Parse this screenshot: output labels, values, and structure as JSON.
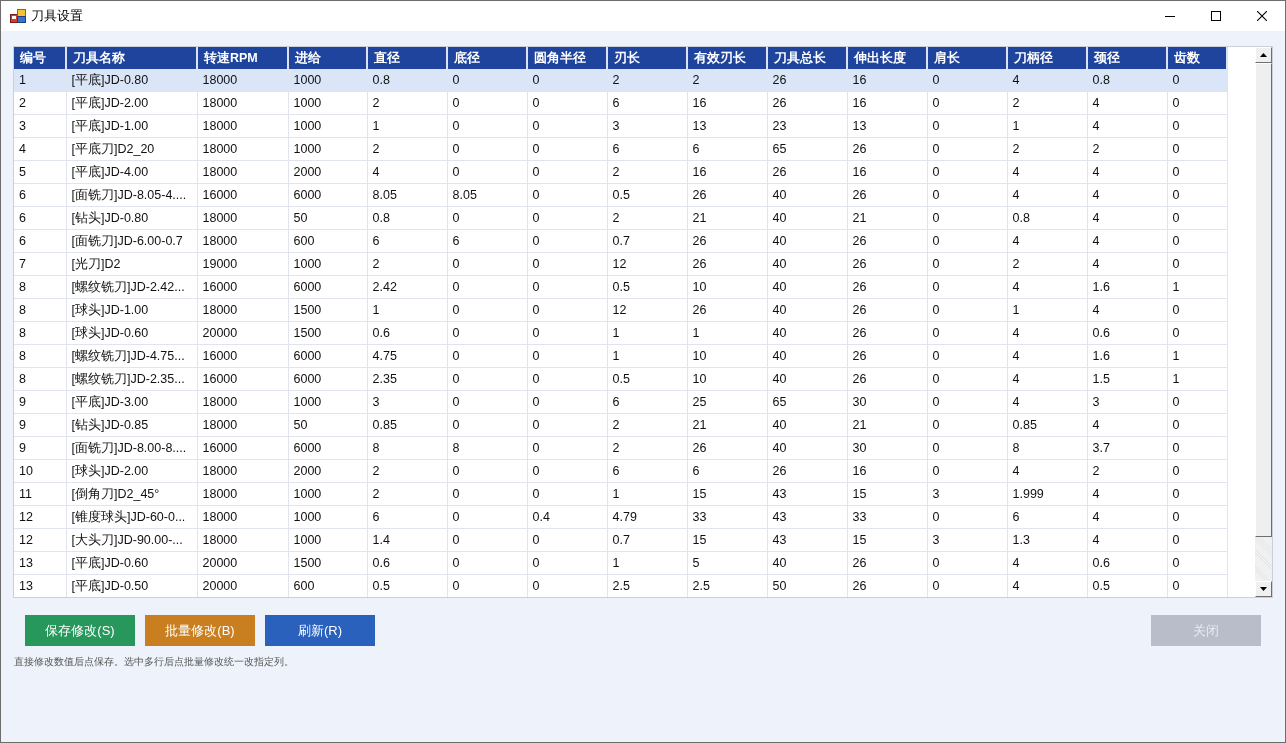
{
  "window": {
    "title": "刀具设置"
  },
  "table": {
    "columns": [
      "编号",
      "刀具名称",
      "转速RPM",
      "进给",
      "直径",
      "底径",
      "圆角半径",
      "刃长",
      "有效刃长",
      "刀具总长",
      "伸出长度",
      "肩长",
      "刀柄径",
      "颈径",
      "齿数"
    ],
    "rows": [
      {
        "selected": true,
        "cells": [
          "1",
          "[平底]JD-0.80",
          "18000",
          "1000",
          "0.8",
          "0",
          "0",
          "2",
          "2",
          "26",
          "16",
          "0",
          "4",
          "0.8",
          "0"
        ]
      },
      {
        "selected": false,
        "cells": [
          "2",
          "[平底]JD-2.00",
          "18000",
          "1000",
          "2",
          "0",
          "0",
          "6",
          "16",
          "26",
          "16",
          "0",
          "2",
          "4",
          "0"
        ]
      },
      {
        "selected": false,
        "cells": [
          "3",
          "[平底]JD-1.00",
          "18000",
          "1000",
          "1",
          "0",
          "0",
          "3",
          "13",
          "23",
          "13",
          "0",
          "1",
          "4",
          "0"
        ]
      },
      {
        "selected": false,
        "cells": [
          "4",
          "[平底刀]D2_20",
          "18000",
          "1000",
          "2",
          "0",
          "0",
          "6",
          "6",
          "65",
          "26",
          "0",
          "2",
          "2",
          "0"
        ]
      },
      {
        "selected": false,
        "cells": [
          "5",
          "[平底]JD-4.00",
          "18000",
          "2000",
          "4",
          "0",
          "0",
          "2",
          "16",
          "26",
          "16",
          "0",
          "4",
          "4",
          "0"
        ]
      },
      {
        "selected": false,
        "cells": [
          "6",
          "[面铣刀]JD-8.05-4....",
          "16000",
          "6000",
          "8.05",
          "8.05",
          "0",
          "0.5",
          "26",
          "40",
          "26",
          "0",
          "4",
          "4",
          "0"
        ]
      },
      {
        "selected": false,
        "cells": [
          "6",
          "[钻头]JD-0.80",
          "18000",
          "50",
          "0.8",
          "0",
          "0",
          "2",
          "21",
          "40",
          "21",
          "0",
          "0.8",
          "4",
          "0"
        ]
      },
      {
        "selected": false,
        "cells": [
          "6",
          "[面铣刀]JD-6.00-0.7",
          "18000",
          "600",
          "6",
          "6",
          "0",
          "0.7",
          "26",
          "40",
          "26",
          "0",
          "4",
          "4",
          "0"
        ]
      },
      {
        "selected": false,
        "cells": [
          "7",
          "[光刀]D2",
          "19000",
          "1000",
          "2",
          "0",
          "0",
          "12",
          "26",
          "40",
          "26",
          "0",
          "2",
          "4",
          "0"
        ]
      },
      {
        "selected": false,
        "cells": [
          "8",
          "[螺纹铣刀]JD-2.42...",
          "16000",
          "6000",
          "2.42",
          "0",
          "0",
          "0.5",
          "10",
          "40",
          "26",
          "0",
          "4",
          "1.6",
          "1"
        ]
      },
      {
        "selected": false,
        "cells": [
          "8",
          "[球头]JD-1.00",
          "18000",
          "1500",
          "1",
          "0",
          "0",
          "12",
          "26",
          "40",
          "26",
          "0",
          "1",
          "4",
          "0"
        ]
      },
      {
        "selected": false,
        "cells": [
          "8",
          "[球头]JD-0.60",
          "20000",
          "1500",
          "0.6",
          "0",
          "0",
          "1",
          "1",
          "40",
          "26",
          "0",
          "4",
          "0.6",
          "0"
        ]
      },
      {
        "selected": false,
        "cells": [
          "8",
          "[螺纹铣刀]JD-4.75...",
          "16000",
          "6000",
          "4.75",
          "0",
          "0",
          "1",
          "10",
          "40",
          "26",
          "0",
          "4",
          "1.6",
          "1"
        ]
      },
      {
        "selected": false,
        "cells": [
          "8",
          "[螺纹铣刀]JD-2.35...",
          "16000",
          "6000",
          "2.35",
          "0",
          "0",
          "0.5",
          "10",
          "40",
          "26",
          "0",
          "4",
          "1.5",
          "1"
        ]
      },
      {
        "selected": false,
        "cells": [
          "9",
          "[平底]JD-3.00",
          "18000",
          "1000",
          "3",
          "0",
          "0",
          "6",
          "25",
          "65",
          "30",
          "0",
          "4",
          "3",
          "0"
        ]
      },
      {
        "selected": false,
        "cells": [
          "9",
          "[钻头]JD-0.85",
          "18000",
          "50",
          "0.85",
          "0",
          "0",
          "2",
          "21",
          "40",
          "21",
          "0",
          "0.85",
          "4",
          "0"
        ]
      },
      {
        "selected": false,
        "cells": [
          "9",
          "[面铣刀]JD-8.00-8....",
          "16000",
          "6000",
          "8",
          "8",
          "0",
          "2",
          "26",
          "40",
          "30",
          "0",
          "8",
          "3.7",
          "0"
        ]
      },
      {
        "selected": false,
        "cells": [
          "10",
          "[球头]JD-2.00",
          "18000",
          "2000",
          "2",
          "0",
          "0",
          "6",
          "6",
          "26",
          "16",
          "0",
          "4",
          "2",
          "0"
        ]
      },
      {
        "selected": false,
        "cells": [
          "11",
          "[倒角刀]D2_45°",
          "18000",
          "1000",
          "2",
          "0",
          "0",
          "1",
          "15",
          "43",
          "15",
          "3",
          "1.999",
          "4",
          "0"
        ]
      },
      {
        "selected": false,
        "cells": [
          "12",
          "[锥度球头]JD-60-0...",
          "18000",
          "1000",
          "6",
          "0",
          "0.4",
          "4.79",
          "33",
          "43",
          "33",
          "0",
          "6",
          "4",
          "0"
        ]
      },
      {
        "selected": false,
        "cells": [
          "12",
          "[大头刀]JD-90.00-...",
          "18000",
          "1000",
          "1.4",
          "0",
          "0",
          "0.7",
          "15",
          "43",
          "15",
          "3",
          "1.3",
          "4",
          "0"
        ]
      },
      {
        "selected": false,
        "cells": [
          "13",
          "[平底]JD-0.60",
          "20000",
          "1500",
          "0.6",
          "0",
          "0",
          "1",
          "5",
          "40",
          "26",
          "0",
          "4",
          "0.6",
          "0"
        ]
      },
      {
        "selected": false,
        "cells": [
          "13",
          "[平底]JD-0.50",
          "20000",
          "600",
          "0.5",
          "0",
          "0",
          "2.5",
          "2.5",
          "50",
          "26",
          "0",
          "4",
          "0.5",
          "0"
        ]
      }
    ]
  },
  "actions": [
    {
      "label": "保存修改(S)",
      "color": "#27975b"
    },
    {
      "label": "批量修改(B)",
      "color": "#c97f1f"
    },
    {
      "label": "刷新(R)",
      "color": "#2a61bd"
    }
  ],
  "close_button": {
    "label": "关闭",
    "disabled": true
  },
  "hint": "直接修改数值后点保存。选中多行后点批量修改统一改指定列。"
}
